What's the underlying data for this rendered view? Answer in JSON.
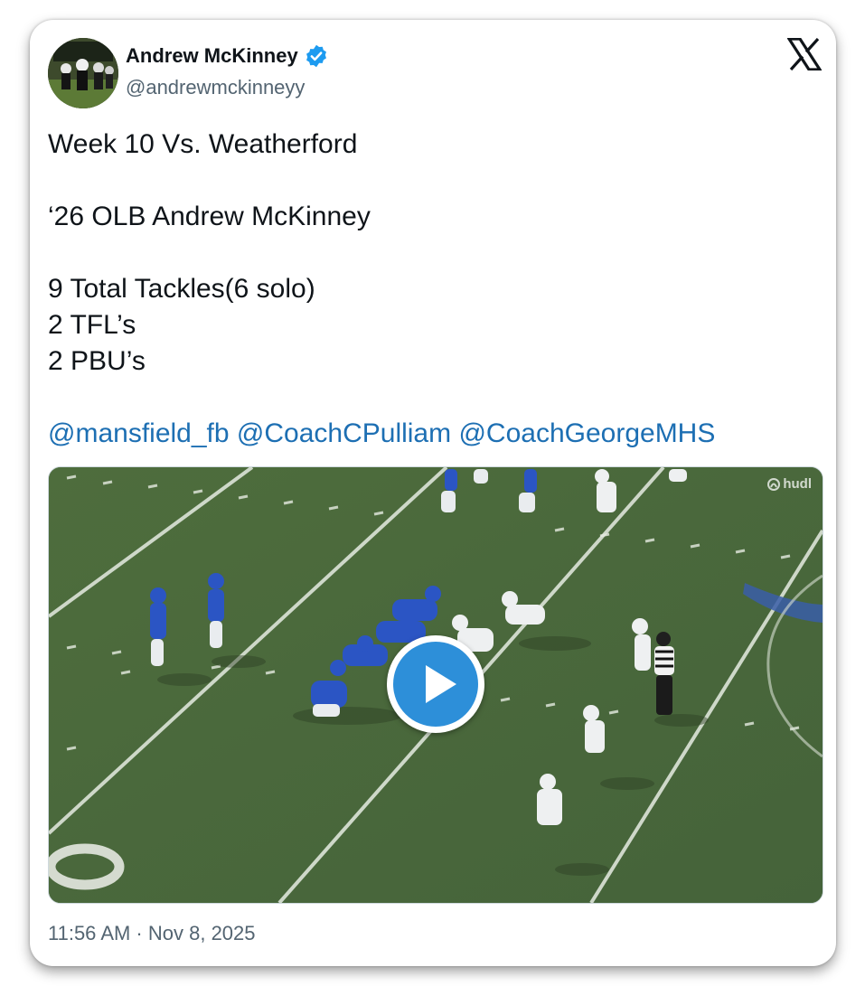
{
  "author": {
    "display_name": "Andrew McKinney",
    "handle": "@andrewmckinneyy",
    "verified": true
  },
  "icons": {
    "verified": "verified-badge-icon",
    "platform_logo": "x-logo-icon",
    "play": "play-icon",
    "watermark": "hudl-logo"
  },
  "tweet": {
    "lines": [
      "Week 10 Vs. Weatherford",
      "",
      "‘26 OLB Andrew McKinney",
      "",
      "9 Total Tackles(6 solo)",
      "2 TFL’s",
      "2 PBU’s",
      ""
    ],
    "mentions": [
      "@mansfield_fb",
      "@CoachCPulliam",
      "@CoachGeorgeMHS"
    ]
  },
  "media": {
    "type": "video",
    "watermark": "hudl"
  },
  "timestamp": "11:56 AM · Nov 8, 2025",
  "colors": {
    "text": "#0f1419",
    "secondary": "#536471",
    "link": "#1d6fb3",
    "verified": "#1d9bf0",
    "play": "#2d8fd9",
    "field": "#4c6a3c"
  }
}
